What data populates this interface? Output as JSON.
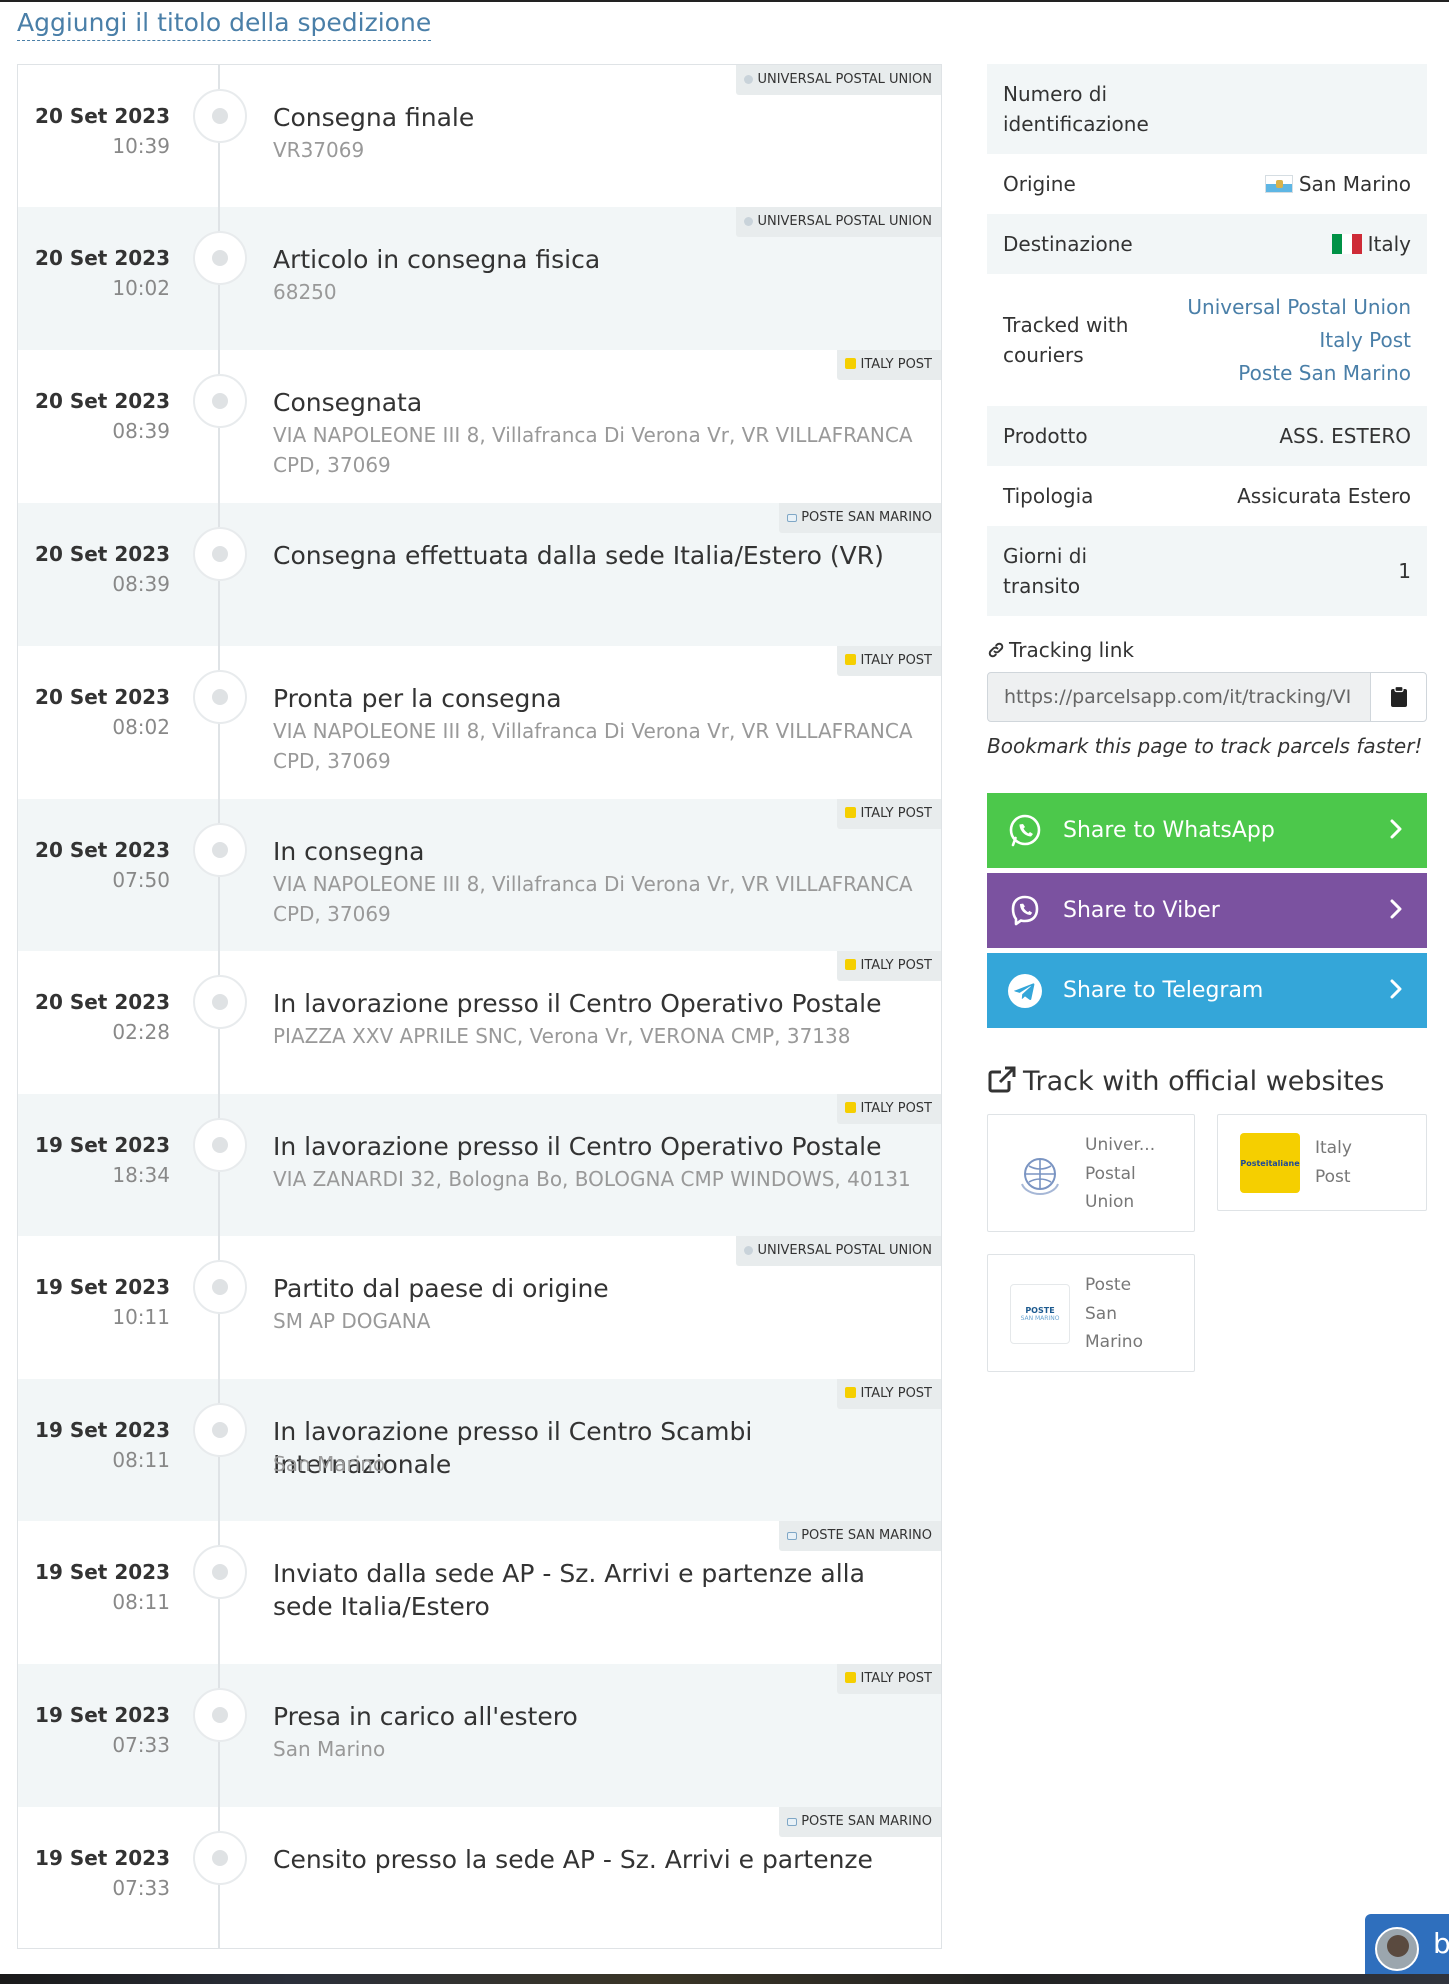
{
  "page": {
    "title_link": "Aggiungi il titolo della spedizione"
  },
  "events": [
    {
      "date": "20 Set 2023",
      "time": "10:39",
      "title": "Consegna finale",
      "subtitle": "VR37069",
      "courier": "UNIVERSAL POSTAL UNION",
      "courier_icon": "upu-icon"
    },
    {
      "date": "20 Set 2023",
      "time": "10:02",
      "title": "Articolo in consegna fisica",
      "subtitle": "68250",
      "courier": "UNIVERSAL POSTAL UNION",
      "courier_icon": "upu-icon"
    },
    {
      "date": "20 Set 2023",
      "time": "08:39",
      "title": "Consegnata",
      "subtitle": "VIA NAPOLEONE III 8, Villafranca Di Verona Vr, VR VILLAFRANCA CPD, 37069",
      "courier": "ITALY POST",
      "courier_icon": "italy-post-icon"
    },
    {
      "date": "20 Set 2023",
      "time": "08:39",
      "title": "Consegna effettuata dalla sede Italia/Estero (VR)",
      "subtitle": "",
      "courier": "POSTE SAN MARINO",
      "courier_icon": "poste-san-marino-icon"
    },
    {
      "date": "20 Set 2023",
      "time": "08:02",
      "title": "Pronta per la consegna",
      "subtitle": "VIA NAPOLEONE III 8, Villafranca Di Verona Vr, VR VILLAFRANCA CPD, 37069",
      "courier": "ITALY POST",
      "courier_icon": "italy-post-icon"
    },
    {
      "date": "20 Set 2023",
      "time": "07:50",
      "title": "In consegna",
      "subtitle": "VIA NAPOLEONE III 8, Villafranca Di Verona Vr, VR VILLAFRANCA CPD, 37069",
      "courier": "ITALY POST",
      "courier_icon": "italy-post-icon"
    },
    {
      "date": "20 Set 2023",
      "time": "02:28",
      "title": "In lavorazione presso il Centro Operativo Postale",
      "subtitle": "PIAZZA XXV APRILE SNC, Verona Vr, VERONA CMP, 37138",
      "courier": "ITALY POST",
      "courier_icon": "italy-post-icon"
    },
    {
      "date": "19 Set 2023",
      "time": "18:34",
      "title": "In lavorazione presso il Centro Operativo Postale",
      "subtitle": "VIA ZANARDI 32, Bologna Bo, BOLOGNA CMP WINDOWS, 40131",
      "courier": "ITALY POST",
      "courier_icon": "italy-post-icon"
    },
    {
      "date": "19 Set 2023",
      "time": "10:11",
      "title": "Partito dal paese di origine",
      "subtitle": "SM AP DOGANA",
      "courier": "UNIVERSAL POSTAL UNION",
      "courier_icon": "upu-icon"
    },
    {
      "date": "19 Set 2023",
      "time": "08:11",
      "title": "In lavorazione presso il Centro Scambi Internazionale",
      "subtitle": "San Marino",
      "courier": "ITALY POST",
      "courier_icon": "italy-post-icon"
    },
    {
      "date": "19 Set 2023",
      "time": "08:11",
      "title": "Inviato dalla sede AP - Sz. Arrivi e partenze alla sede Italia/Estero",
      "subtitle": "",
      "courier": "POSTE SAN MARINO",
      "courier_icon": "poste-san-marino-icon"
    },
    {
      "date": "19 Set 2023",
      "time": "07:33",
      "title": "Presa in carico all'estero",
      "subtitle": "San Marino",
      "courier": "ITALY POST",
      "courier_icon": "italy-post-icon"
    },
    {
      "date": "19 Set 2023",
      "time": "07:33",
      "title": "Censito presso la sede AP - Sz. Arrivi e partenze",
      "subtitle": "",
      "courier": "POSTE SAN MARINO",
      "courier_icon": "poste-san-marino-icon"
    }
  ],
  "info": {
    "id_label": "Numero di identificazione",
    "origin_label": "Origine",
    "origin_value": "San Marino",
    "destination_label": "Destinazione",
    "destination_value": "Italy",
    "tracked_label": "Tracked with couriers",
    "tracked_couriers": [
      "Universal Postal Union",
      "Italy Post",
      "Poste San Marino"
    ],
    "product_label": "Prodotto",
    "product_value": "ASS. ESTERO",
    "type_label": "Tipologia",
    "type_value": "Assicurata Estero",
    "transit_label": "Giorni di transito",
    "transit_value": "1"
  },
  "tracking": {
    "label": "Tracking link",
    "url": "https://parcelsapp.com/it/tracking/VI",
    "bookmark_note": "Bookmark this page to track parcels faster!"
  },
  "share": {
    "whatsapp": "Share to WhatsApp",
    "viber": "Share to Viber",
    "telegram": "Share to Telegram"
  },
  "official": {
    "title": "Track with official websites",
    "cards": [
      {
        "name_lines": [
          "Univer...",
          "Postal",
          "Union"
        ],
        "logo": "upu-logo"
      },
      {
        "name_lines": [
          "Italy",
          "Post"
        ],
        "logo": "poste-italiane-logo",
        "logo_text": "Posteitaliane"
      },
      {
        "name_lines": [
          "Poste",
          "San",
          "Marino"
        ],
        "logo": "poste-san-marino-logo",
        "logo_text": "POSTE",
        "logo_subtext": "SAN MARINO"
      }
    ]
  },
  "chat": {
    "letter": "b"
  },
  "colors": {
    "link": "#4a7fa8",
    "whatsapp": "#4cc84b",
    "viber": "#7b52a0",
    "telegram": "#34a6d9",
    "row_shade": "#f2f6f7",
    "italy_post_yellow": "#f5cf00"
  }
}
